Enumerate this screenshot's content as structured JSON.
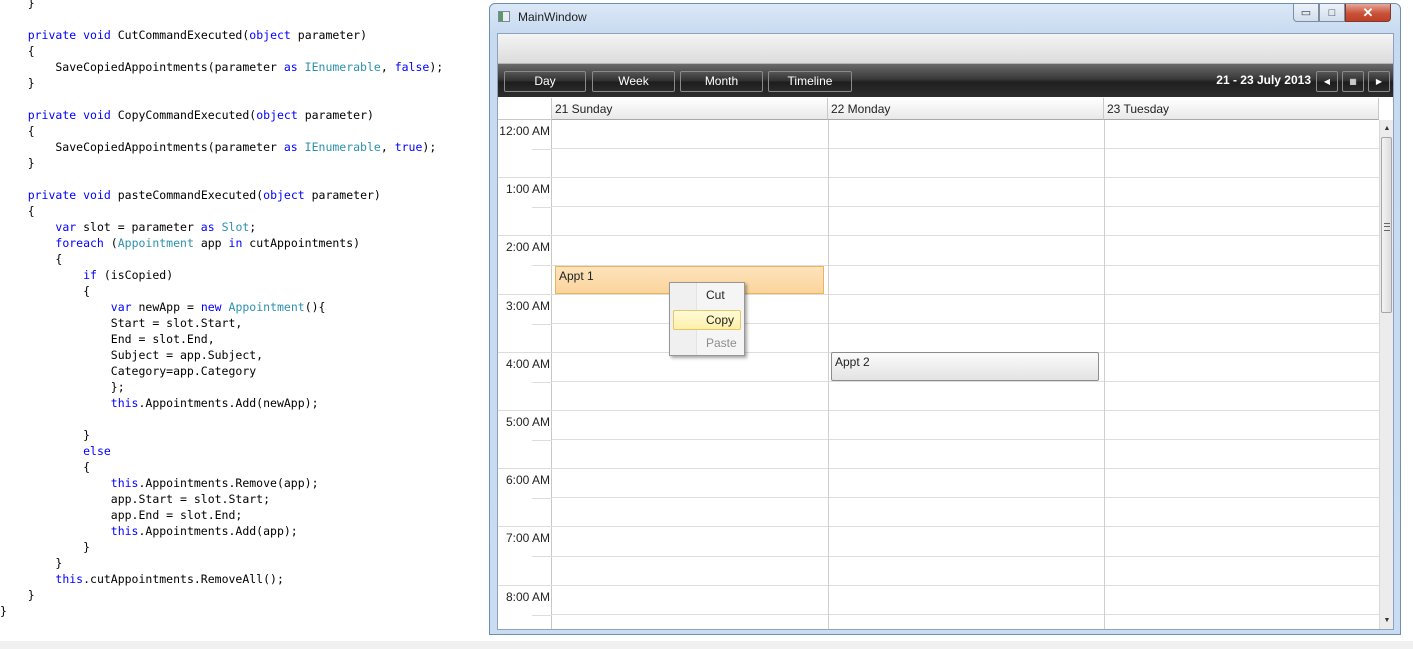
{
  "code": {
    "lines": [
      [
        {
          "t": "    }"
        }
      ],
      [
        {
          "t": ""
        }
      ],
      [
        {
          "t": "    "
        },
        {
          "t": "private",
          "c": "kw"
        },
        {
          "t": " "
        },
        {
          "t": "void",
          "c": "kw"
        },
        {
          "t": " CutCommandExecuted("
        },
        {
          "t": "object",
          "c": "kw"
        },
        {
          "t": " parameter)"
        }
      ],
      [
        {
          "t": "    {"
        }
      ],
      [
        {
          "t": "        SaveCopiedAppointments(parameter "
        },
        {
          "t": "as",
          "c": "kw"
        },
        {
          "t": " "
        },
        {
          "t": "IEnumerable",
          "c": "ty"
        },
        {
          "t": ", "
        },
        {
          "t": "false",
          "c": "kw"
        },
        {
          "t": ");"
        }
      ],
      [
        {
          "t": "    }"
        }
      ],
      [
        {
          "t": ""
        }
      ],
      [
        {
          "t": "    "
        },
        {
          "t": "private",
          "c": "kw"
        },
        {
          "t": " "
        },
        {
          "t": "void",
          "c": "kw"
        },
        {
          "t": " CopyCommandExecuted("
        },
        {
          "t": "object",
          "c": "kw"
        },
        {
          "t": " parameter)"
        }
      ],
      [
        {
          "t": "    {"
        }
      ],
      [
        {
          "t": "        SaveCopiedAppointments(parameter "
        },
        {
          "t": "as",
          "c": "kw"
        },
        {
          "t": " "
        },
        {
          "t": "IEnumerable",
          "c": "ty"
        },
        {
          "t": ", "
        },
        {
          "t": "true",
          "c": "kw"
        },
        {
          "t": ");"
        }
      ],
      [
        {
          "t": "    }"
        }
      ],
      [
        {
          "t": ""
        }
      ],
      [
        {
          "t": "    "
        },
        {
          "t": "private",
          "c": "kw"
        },
        {
          "t": " "
        },
        {
          "t": "void",
          "c": "kw"
        },
        {
          "t": " pasteCommandExecuted("
        },
        {
          "t": "object",
          "c": "kw"
        },
        {
          "t": " parameter)"
        }
      ],
      [
        {
          "t": "    {"
        }
      ],
      [
        {
          "t": "        "
        },
        {
          "t": "var",
          "c": "kw"
        },
        {
          "t": " slot = parameter "
        },
        {
          "t": "as",
          "c": "kw"
        },
        {
          "t": " "
        },
        {
          "t": "Slot",
          "c": "ty"
        },
        {
          "t": ";"
        }
      ],
      [
        {
          "t": "        "
        },
        {
          "t": "foreach",
          "c": "kw"
        },
        {
          "t": " ("
        },
        {
          "t": "Appointment",
          "c": "ty"
        },
        {
          "t": " app "
        },
        {
          "t": "in",
          "c": "kw"
        },
        {
          "t": " cutAppointments)"
        }
      ],
      [
        {
          "t": "        {"
        }
      ],
      [
        {
          "t": "            "
        },
        {
          "t": "if",
          "c": "kw"
        },
        {
          "t": " (isCopied)"
        }
      ],
      [
        {
          "t": "            {"
        }
      ],
      [
        {
          "t": "                "
        },
        {
          "t": "var",
          "c": "kw"
        },
        {
          "t": " newApp = "
        },
        {
          "t": "new",
          "c": "kw"
        },
        {
          "t": " "
        },
        {
          "t": "Appointment",
          "c": "ty"
        },
        {
          "t": "(){"
        }
      ],
      [
        {
          "t": "                Start = slot.Start,"
        }
      ],
      [
        {
          "t": "                End = slot.End,"
        }
      ],
      [
        {
          "t": "                Subject = app.Subject,"
        }
      ],
      [
        {
          "t": "                Category=app.Category"
        }
      ],
      [
        {
          "t": "                };"
        }
      ],
      [
        {
          "t": "                "
        },
        {
          "t": "this",
          "c": "kw"
        },
        {
          "t": ".Appointments.Add(newApp);"
        }
      ],
      [
        {
          "t": ""
        }
      ],
      [
        {
          "t": "            }"
        }
      ],
      [
        {
          "t": "            "
        },
        {
          "t": "else",
          "c": "kw"
        }
      ],
      [
        {
          "t": "            {"
        }
      ],
      [
        {
          "t": "                "
        },
        {
          "t": "this",
          "c": "kw"
        },
        {
          "t": ".Appointments.Remove(app);"
        }
      ],
      [
        {
          "t": "                app.Start = slot.Start;"
        }
      ],
      [
        {
          "t": "                app.End = slot.End;"
        }
      ],
      [
        {
          "t": "                "
        },
        {
          "t": "this",
          "c": "kw"
        },
        {
          "t": ".Appointments.Add(app);"
        }
      ],
      [
        {
          "t": "            }"
        }
      ],
      [
        {
          "t": "        }"
        }
      ],
      [
        {
          "t": "        "
        },
        {
          "t": "this",
          "c": "kw"
        },
        {
          "t": ".cutAppointments.RemoveAll();"
        }
      ],
      [
        {
          "t": "    }"
        }
      ],
      [
        {
          "t": "}"
        }
      ]
    ],
    "colors": {
      "keyword": "#0000ff",
      "type": "#2b91af",
      "text": "#000000"
    }
  },
  "window": {
    "title": "MainWindow",
    "icons": {
      "app": "window-app-icon",
      "minimize": "minimize-icon",
      "maximize": "maximize-icon",
      "close": "close-icon"
    },
    "glyphs": {
      "minimize": "▭",
      "maximize": "□",
      "close": "✕"
    }
  },
  "scheduler": {
    "view_tabs": [
      {
        "id": "day",
        "label": "Day",
        "active": false
      },
      {
        "id": "week",
        "label": "Week",
        "active": true
      },
      {
        "id": "month",
        "label": "Month",
        "active": false
      },
      {
        "id": "timeline",
        "label": "Timeline",
        "active": false
      }
    ],
    "date_range": "21 - 23 July 2013",
    "nav": {
      "prev_glyph": "◀",
      "calendar_glyph": "▦",
      "next_glyph": "▶",
      "icons": {
        "prev": "chevron-left-icon",
        "calendar": "calendar-icon",
        "next": "chevron-right-icon"
      }
    },
    "days": [
      "21 Sunday",
      "22 Monday",
      "23 Tuesday"
    ],
    "time_labels": [
      "12:00 AM",
      "1:00 AM",
      "2:00 AM",
      "3:00 AM",
      "4:00 AM",
      "5:00 AM",
      "6:00 AM",
      "7:00 AM",
      "8:00 AM"
    ],
    "appointments": [
      {
        "subject": "Appt 1",
        "start": "2:30 AM",
        "end": "3:00 AM",
        "day": "21 Sunday",
        "color": "#fbd49c"
      },
      {
        "subject": "Appt 2",
        "start": "4:00 AM",
        "end": "4:30 AM",
        "day": "22 Monday",
        "color": "#e9e9e9"
      }
    ],
    "scroll": {
      "up_glyph": "▲",
      "down_glyph": "▼"
    },
    "accent_color": "#f8a13f"
  },
  "context_menu": {
    "items": [
      {
        "label": "Cut",
        "enabled": true,
        "highlighted": false
      },
      {
        "label": "Copy",
        "enabled": true,
        "highlighted": true
      },
      {
        "label": "Paste",
        "enabled": false,
        "highlighted": false
      }
    ]
  }
}
